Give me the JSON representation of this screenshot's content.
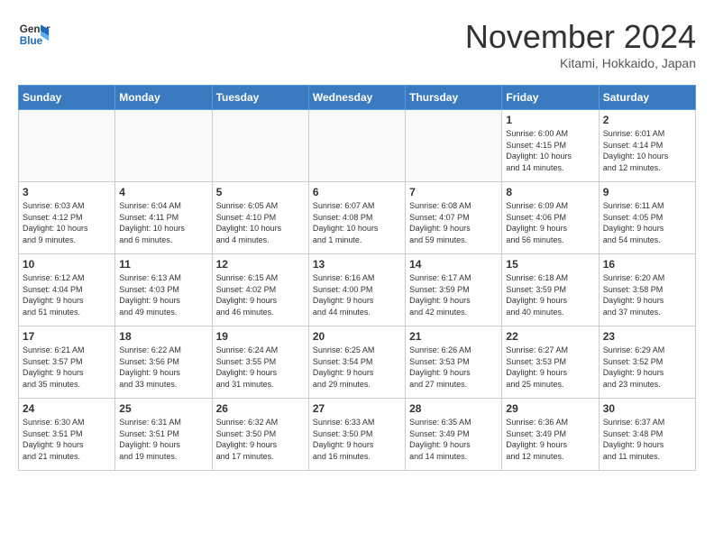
{
  "header": {
    "logo_line1": "General",
    "logo_line2": "Blue",
    "month": "November 2024",
    "location": "Kitami, Hokkaido, Japan"
  },
  "weekdays": [
    "Sunday",
    "Monday",
    "Tuesday",
    "Wednesday",
    "Thursday",
    "Friday",
    "Saturday"
  ],
  "weeks": [
    [
      {
        "day": "",
        "info": ""
      },
      {
        "day": "",
        "info": ""
      },
      {
        "day": "",
        "info": ""
      },
      {
        "day": "",
        "info": ""
      },
      {
        "day": "",
        "info": ""
      },
      {
        "day": "1",
        "info": "Sunrise: 6:00 AM\nSunset: 4:15 PM\nDaylight: 10 hours\nand 14 minutes."
      },
      {
        "day": "2",
        "info": "Sunrise: 6:01 AM\nSunset: 4:14 PM\nDaylight: 10 hours\nand 12 minutes."
      }
    ],
    [
      {
        "day": "3",
        "info": "Sunrise: 6:03 AM\nSunset: 4:12 PM\nDaylight: 10 hours\nand 9 minutes."
      },
      {
        "day": "4",
        "info": "Sunrise: 6:04 AM\nSunset: 4:11 PM\nDaylight: 10 hours\nand 6 minutes."
      },
      {
        "day": "5",
        "info": "Sunrise: 6:05 AM\nSunset: 4:10 PM\nDaylight: 10 hours\nand 4 minutes."
      },
      {
        "day": "6",
        "info": "Sunrise: 6:07 AM\nSunset: 4:08 PM\nDaylight: 10 hours\nand 1 minute."
      },
      {
        "day": "7",
        "info": "Sunrise: 6:08 AM\nSunset: 4:07 PM\nDaylight: 9 hours\nand 59 minutes."
      },
      {
        "day": "8",
        "info": "Sunrise: 6:09 AM\nSunset: 4:06 PM\nDaylight: 9 hours\nand 56 minutes."
      },
      {
        "day": "9",
        "info": "Sunrise: 6:11 AM\nSunset: 4:05 PM\nDaylight: 9 hours\nand 54 minutes."
      }
    ],
    [
      {
        "day": "10",
        "info": "Sunrise: 6:12 AM\nSunset: 4:04 PM\nDaylight: 9 hours\nand 51 minutes."
      },
      {
        "day": "11",
        "info": "Sunrise: 6:13 AM\nSunset: 4:03 PM\nDaylight: 9 hours\nand 49 minutes."
      },
      {
        "day": "12",
        "info": "Sunrise: 6:15 AM\nSunset: 4:02 PM\nDaylight: 9 hours\nand 46 minutes."
      },
      {
        "day": "13",
        "info": "Sunrise: 6:16 AM\nSunset: 4:00 PM\nDaylight: 9 hours\nand 44 minutes."
      },
      {
        "day": "14",
        "info": "Sunrise: 6:17 AM\nSunset: 3:59 PM\nDaylight: 9 hours\nand 42 minutes."
      },
      {
        "day": "15",
        "info": "Sunrise: 6:18 AM\nSunset: 3:59 PM\nDaylight: 9 hours\nand 40 minutes."
      },
      {
        "day": "16",
        "info": "Sunrise: 6:20 AM\nSunset: 3:58 PM\nDaylight: 9 hours\nand 37 minutes."
      }
    ],
    [
      {
        "day": "17",
        "info": "Sunrise: 6:21 AM\nSunset: 3:57 PM\nDaylight: 9 hours\nand 35 minutes."
      },
      {
        "day": "18",
        "info": "Sunrise: 6:22 AM\nSunset: 3:56 PM\nDaylight: 9 hours\nand 33 minutes."
      },
      {
        "day": "19",
        "info": "Sunrise: 6:24 AM\nSunset: 3:55 PM\nDaylight: 9 hours\nand 31 minutes."
      },
      {
        "day": "20",
        "info": "Sunrise: 6:25 AM\nSunset: 3:54 PM\nDaylight: 9 hours\nand 29 minutes."
      },
      {
        "day": "21",
        "info": "Sunrise: 6:26 AM\nSunset: 3:53 PM\nDaylight: 9 hours\nand 27 minutes."
      },
      {
        "day": "22",
        "info": "Sunrise: 6:27 AM\nSunset: 3:53 PM\nDaylight: 9 hours\nand 25 minutes."
      },
      {
        "day": "23",
        "info": "Sunrise: 6:29 AM\nSunset: 3:52 PM\nDaylight: 9 hours\nand 23 minutes."
      }
    ],
    [
      {
        "day": "24",
        "info": "Sunrise: 6:30 AM\nSunset: 3:51 PM\nDaylight: 9 hours\nand 21 minutes."
      },
      {
        "day": "25",
        "info": "Sunrise: 6:31 AM\nSunset: 3:51 PM\nDaylight: 9 hours\nand 19 minutes."
      },
      {
        "day": "26",
        "info": "Sunrise: 6:32 AM\nSunset: 3:50 PM\nDaylight: 9 hours\nand 17 minutes."
      },
      {
        "day": "27",
        "info": "Sunrise: 6:33 AM\nSunset: 3:50 PM\nDaylight: 9 hours\nand 16 minutes."
      },
      {
        "day": "28",
        "info": "Sunrise: 6:35 AM\nSunset: 3:49 PM\nDaylight: 9 hours\nand 14 minutes."
      },
      {
        "day": "29",
        "info": "Sunrise: 6:36 AM\nSunset: 3:49 PM\nDaylight: 9 hours\nand 12 minutes."
      },
      {
        "day": "30",
        "info": "Sunrise: 6:37 AM\nSunset: 3:48 PM\nDaylight: 9 hours\nand 11 minutes."
      }
    ]
  ]
}
